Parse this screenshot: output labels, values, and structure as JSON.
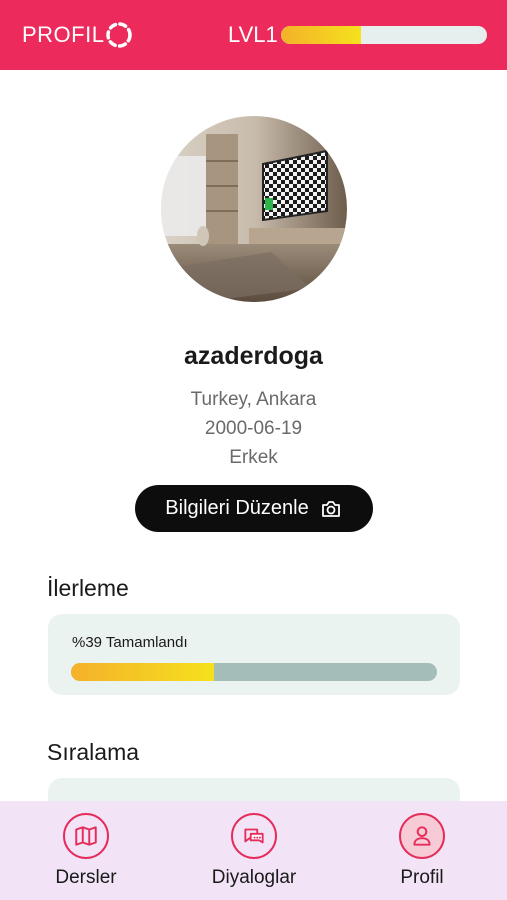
{
  "header": {
    "title": "PROFIL",
    "level_label": "LVL1",
    "level_progress": 0.39,
    "background_color": "#ec2b5c"
  },
  "profile": {
    "username": "azaderdoga",
    "location": "Turkey, Ankara",
    "birth_date": "2000-06-19",
    "gender": "Erkek",
    "edit_button_label": "Bilgileri Düzenle"
  },
  "progress_section": {
    "title": "İlerleme",
    "status_text": "%39 Tamamlandı",
    "percent": 39
  },
  "ranking_section": {
    "title": "Sıralama"
  },
  "bottom_nav": {
    "items": [
      {
        "label": "Dersler",
        "icon": "map-icon",
        "active": false
      },
      {
        "label": "Diyaloglar",
        "icon": "chat-icon",
        "active": false
      },
      {
        "label": "Profil",
        "icon": "user-icon",
        "active": true
      }
    ]
  },
  "colors": {
    "accent": "#ec2b5c",
    "progress_start": "#f4b12a",
    "progress_end": "#f5e11e",
    "card_bg": "#ebf3f1",
    "nav_bg": "#f2e4f6"
  }
}
